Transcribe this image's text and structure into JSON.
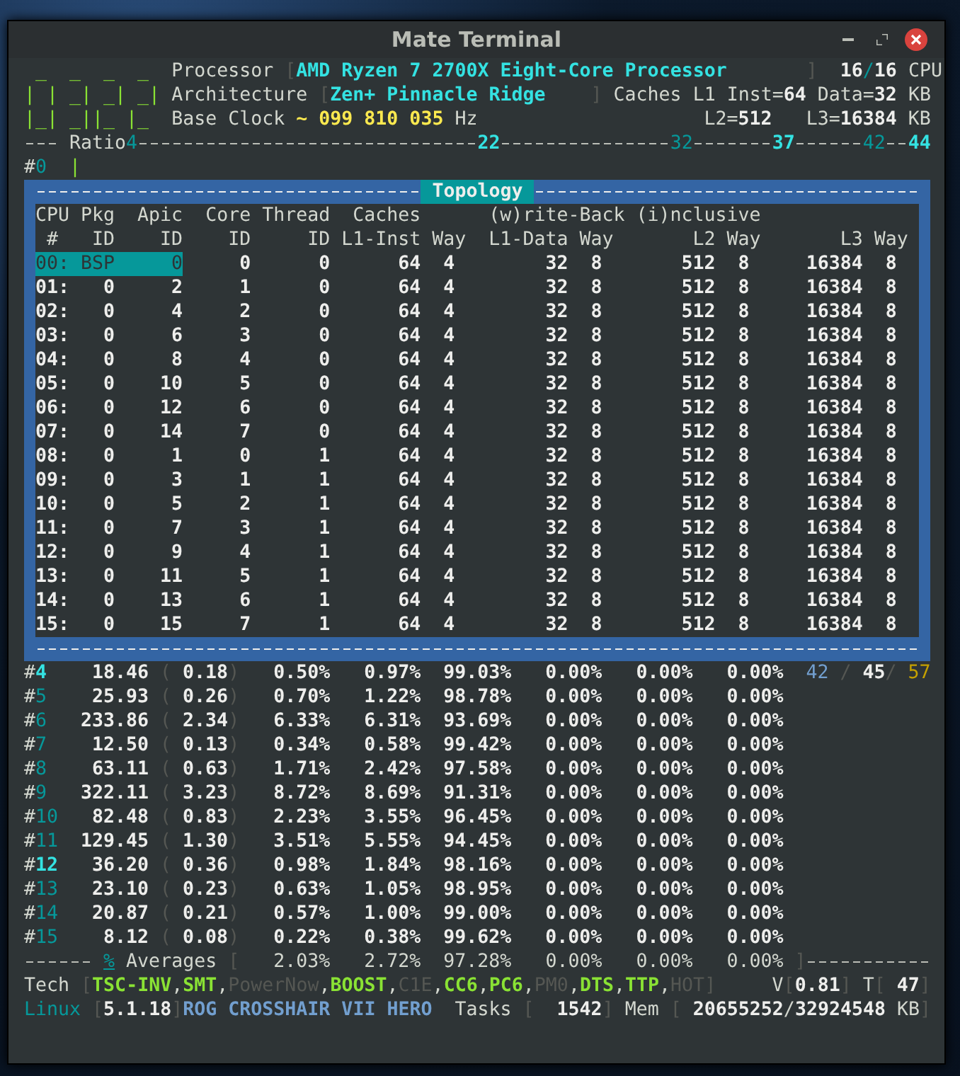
{
  "window": {
    "title": "Mate Terminal"
  },
  "header": {
    "logo_lines": [
      " _  _  _  _",
      "| | _| _| _|",
      "|_| _||_ |_"
    ],
    "processor": {
      "label": "Processor",
      "open": "[",
      "value": "AMD Ryzen 7 2700X Eight-Core Processor",
      "close": "]",
      "cpus_online": "16",
      "slash": "/",
      "cpus_total": "16",
      "unit": "CPU"
    },
    "architecture": {
      "label": "Architecture",
      "open": "[",
      "value": "Zen+ Pinnacle Ridge",
      "close": "]",
      "caches_label": "Caches",
      "l1_inst_label": "L1 Inst=",
      "l1_inst": "64",
      "l1_data_label": "Data=",
      "l1_data": "32",
      "unit": "KB"
    },
    "base_clock": {
      "label": "Base Clock",
      "tilde": "~",
      "value": "099 810 035",
      "unit": "Hz",
      "l2_label": "L2=",
      "l2": "512",
      "l3_label": "L3=",
      "l3": "16384",
      "l3_unit": "KB"
    }
  },
  "ratio": {
    "label": "Ratio",
    "markers": [
      {
        "text": "4",
        "highlighted": false
      },
      {
        "text": "22",
        "highlighted": true
      },
      {
        "text": "32",
        "highlighted": false
      },
      {
        "text": "37",
        "highlighted": true
      },
      {
        "text": "42",
        "highlighted": false
      },
      {
        "text": "44",
        "highlighted": true
      }
    ]
  },
  "cursor_line": {
    "prefix": "#",
    "cpu": "0",
    "bar": "|"
  },
  "topology": {
    "title": "Topology",
    "group_label": "(w)rite-Back (i)nclusive",
    "columns": [
      {
        "top": "CPU",
        "bottom": "#"
      },
      {
        "top": "Pkg",
        "bottom": "ID"
      },
      {
        "top": "Apic",
        "bottom": "ID"
      },
      {
        "top": "Core",
        "bottom": "ID"
      },
      {
        "top": "Thread",
        "bottom": "ID"
      },
      {
        "top": "Caches",
        "bottom": "L1-Inst"
      },
      {
        "bottom": "Way"
      },
      {
        "bottom": "L1-Data"
      },
      {
        "bottom": "Way"
      },
      {
        "bottom": "L2"
      },
      {
        "bottom": "Way"
      },
      {
        "bottom": "L3"
      },
      {
        "bottom": "Way"
      }
    ],
    "rows": [
      {
        "cells": [
          "00:",
          "BSP",
          "0",
          "0",
          "0",
          "64",
          "4",
          "32",
          "8",
          "512",
          "8",
          "16384",
          "8"
        ],
        "selected": true
      },
      {
        "cells": [
          "01:",
          "0",
          "2",
          "1",
          "0",
          "64",
          "4",
          "32",
          "8",
          "512",
          "8",
          "16384",
          "8"
        ],
        "selected": false
      },
      {
        "cells": [
          "02:",
          "0",
          "4",
          "2",
          "0",
          "64",
          "4",
          "32",
          "8",
          "512",
          "8",
          "16384",
          "8"
        ],
        "selected": false
      },
      {
        "cells": [
          "03:",
          "0",
          "6",
          "3",
          "0",
          "64",
          "4",
          "32",
          "8",
          "512",
          "8",
          "16384",
          "8"
        ],
        "selected": false
      },
      {
        "cells": [
          "04:",
          "0",
          "8",
          "4",
          "0",
          "64",
          "4",
          "32",
          "8",
          "512",
          "8",
          "16384",
          "8"
        ],
        "selected": false
      },
      {
        "cells": [
          "05:",
          "0",
          "10",
          "5",
          "0",
          "64",
          "4",
          "32",
          "8",
          "512",
          "8",
          "16384",
          "8"
        ],
        "selected": false
      },
      {
        "cells": [
          "06:",
          "0",
          "12",
          "6",
          "0",
          "64",
          "4",
          "32",
          "8",
          "512",
          "8",
          "16384",
          "8"
        ],
        "selected": false
      },
      {
        "cells": [
          "07:",
          "0",
          "14",
          "7",
          "0",
          "64",
          "4",
          "32",
          "8",
          "512",
          "8",
          "16384",
          "8"
        ],
        "selected": false
      },
      {
        "cells": [
          "08:",
          "0",
          "1",
          "0",
          "1",
          "64",
          "4",
          "32",
          "8",
          "512",
          "8",
          "16384",
          "8"
        ],
        "selected": false
      },
      {
        "cells": [
          "09:",
          "0",
          "3",
          "1",
          "1",
          "64",
          "4",
          "32",
          "8",
          "512",
          "8",
          "16384",
          "8"
        ],
        "selected": false
      },
      {
        "cells": [
          "10:",
          "0",
          "5",
          "2",
          "1",
          "64",
          "4",
          "32",
          "8",
          "512",
          "8",
          "16384",
          "8"
        ],
        "selected": false
      },
      {
        "cells": [
          "11:",
          "0",
          "7",
          "3",
          "1",
          "64",
          "4",
          "32",
          "8",
          "512",
          "8",
          "16384",
          "8"
        ],
        "selected": false
      },
      {
        "cells": [
          "12:",
          "0",
          "9",
          "4",
          "1",
          "64",
          "4",
          "32",
          "8",
          "512",
          "8",
          "16384",
          "8"
        ],
        "selected": false
      },
      {
        "cells": [
          "13:",
          "0",
          "11",
          "5",
          "1",
          "64",
          "4",
          "32",
          "8",
          "512",
          "8",
          "16384",
          "8"
        ],
        "selected": false
      },
      {
        "cells": [
          "14:",
          "0",
          "13",
          "6",
          "1",
          "64",
          "4",
          "32",
          "8",
          "512",
          "8",
          "16384",
          "8"
        ],
        "selected": false
      },
      {
        "cells": [
          "15:",
          "0",
          "15",
          "7",
          "1",
          "64",
          "4",
          "32",
          "8",
          "512",
          "8",
          "16384",
          "8"
        ],
        "selected": false
      }
    ]
  },
  "stats": {
    "rows": [
      {
        "prefix": "#",
        "cpu": "4",
        "highlighted": true,
        "freq": "18.46",
        "open": "(",
        "ratio": "0.18",
        "close": ")",
        "percentages": [
          "0.50%",
          "0.97%",
          "99.03%",
          "0.00%",
          "0.00%",
          "0.00%"
        ]
      },
      {
        "prefix": "#",
        "cpu": "5",
        "highlighted": false,
        "freq": "25.93",
        "open": "(",
        "ratio": "0.26",
        "close": ")",
        "percentages": [
          "0.70%",
          "1.22%",
          "98.78%",
          "0.00%",
          "0.00%",
          "0.00%"
        ]
      },
      {
        "prefix": "#",
        "cpu": "6",
        "highlighted": false,
        "freq": "233.86",
        "open": "(",
        "ratio": "2.34",
        "close": ")",
        "percentages": [
          "6.33%",
          "6.31%",
          "93.69%",
          "0.00%",
          "0.00%",
          "0.00%"
        ]
      },
      {
        "prefix": "#",
        "cpu": "7",
        "highlighted": false,
        "freq": "12.50",
        "open": "(",
        "ratio": "0.13",
        "close": ")",
        "percentages": [
          "0.34%",
          "0.58%",
          "99.42%",
          "0.00%",
          "0.00%",
          "0.00%"
        ]
      },
      {
        "prefix": "#",
        "cpu": "8",
        "highlighted": false,
        "freq": "63.11",
        "open": "(",
        "ratio": "0.63",
        "close": ")",
        "percentages": [
          "1.71%",
          "2.42%",
          "97.58%",
          "0.00%",
          "0.00%",
          "0.00%"
        ]
      },
      {
        "prefix": "#",
        "cpu": "9",
        "highlighted": false,
        "freq": "322.11",
        "open": "(",
        "ratio": "3.23",
        "close": ")",
        "percentages": [
          "8.72%",
          "8.69%",
          "91.31%",
          "0.00%",
          "0.00%",
          "0.00%"
        ]
      },
      {
        "prefix": "#",
        "cpu": "10",
        "highlighted": false,
        "freq": "82.48",
        "open": "(",
        "ratio": "0.83",
        "close": ")",
        "percentages": [
          "2.23%",
          "3.55%",
          "96.45%",
          "0.00%",
          "0.00%",
          "0.00%"
        ]
      },
      {
        "prefix": "#",
        "cpu": "11",
        "highlighted": false,
        "freq": "129.45",
        "open": "(",
        "ratio": "1.30",
        "close": ")",
        "percentages": [
          "3.51%",
          "5.55%",
          "94.45%",
          "0.00%",
          "0.00%",
          "0.00%"
        ]
      },
      {
        "prefix": "#",
        "cpu": "12",
        "highlighted": true,
        "freq": "36.20",
        "open": "(",
        "ratio": "0.36",
        "close": ")",
        "percentages": [
          "0.98%",
          "1.84%",
          "98.16%",
          "0.00%",
          "0.00%",
          "0.00%"
        ]
      },
      {
        "prefix": "#",
        "cpu": "13",
        "highlighted": false,
        "freq": "23.10",
        "open": "(",
        "ratio": "0.23",
        "close": ")",
        "percentages": [
          "0.63%",
          "1.05%",
          "98.95%",
          "0.00%",
          "0.00%",
          "0.00%"
        ]
      },
      {
        "prefix": "#",
        "cpu": "14",
        "highlighted": false,
        "freq": "20.87",
        "open": "(",
        "ratio": "0.21",
        "close": ")",
        "percentages": [
          "0.57%",
          "1.00%",
          "99.00%",
          "0.00%",
          "0.00%",
          "0.00%"
        ]
      },
      {
        "prefix": "#",
        "cpu": "15",
        "highlighted": false,
        "freq": "8.12",
        "open": "(",
        "ratio": "0.08",
        "close": ")",
        "percentages": [
          "0.22%",
          "0.38%",
          "99.62%",
          "0.00%",
          "0.00%",
          "0.00%"
        ]
      }
    ],
    "thermal": [
      {
        "text": "42",
        "kind": "low"
      },
      {
        "text": "/",
        "kind": "separator"
      },
      {
        "text": "45",
        "kind": "current"
      },
      {
        "text": "/",
        "kind": "separator"
      },
      {
        "text": "57",
        "kind": "high"
      }
    ]
  },
  "averages": {
    "symbol": "%",
    "label": "Averages",
    "open": "[",
    "values": [
      "2.03%",
      "2.72%",
      "97.28%",
      "0.00%",
      "0.00%",
      "0.00%"
    ],
    "close": "]"
  },
  "tech": {
    "label": "Tech",
    "open": "[",
    "flags": [
      {
        "label": "TSC-INV",
        "on": true,
        "sep": ","
      },
      {
        "label": "SMT",
        "on": true,
        "sep": ","
      },
      {
        "label": "PowerNow",
        "on": false,
        "sep": ","
      },
      {
        "label": "BOOST",
        "on": true,
        "sep": ","
      },
      {
        "label": "C1E",
        "on": false,
        "sep": ","
      },
      {
        "label": "CC6",
        "on": true,
        "sep": ","
      },
      {
        "label": "PC6",
        "on": true,
        "sep": ","
      },
      {
        "label": "PM0",
        "on": false,
        "sep": ","
      },
      {
        "label": "DTS",
        "on": true,
        "sep": ","
      },
      {
        "label": "TTP",
        "on": true,
        "sep": ","
      },
      {
        "label": "HOT",
        "on": false
      }
    ],
    "close": "]",
    "voltage": {
      "label": "V",
      "open": "[",
      "value": "0.81",
      "close": "]"
    },
    "temperature": {
      "label": "T",
      "open": "[",
      "value": "47",
      "close": "]"
    }
  },
  "system": {
    "os": "Linux",
    "open": "[",
    "kernel": "5.1.18",
    "close": "]",
    "board": "ROG CROSSHAIR VII HERO",
    "tasks_label": "Tasks",
    "tasks_open": "[",
    "tasks": "1542",
    "tasks_close": "]",
    "mem_label": "Mem",
    "mem_open": "[",
    "mem_used": "20655252",
    "mem_sep": "/",
    "mem_total": "32924548",
    "mem_unit": "KB",
    "mem_close": "]"
  }
}
